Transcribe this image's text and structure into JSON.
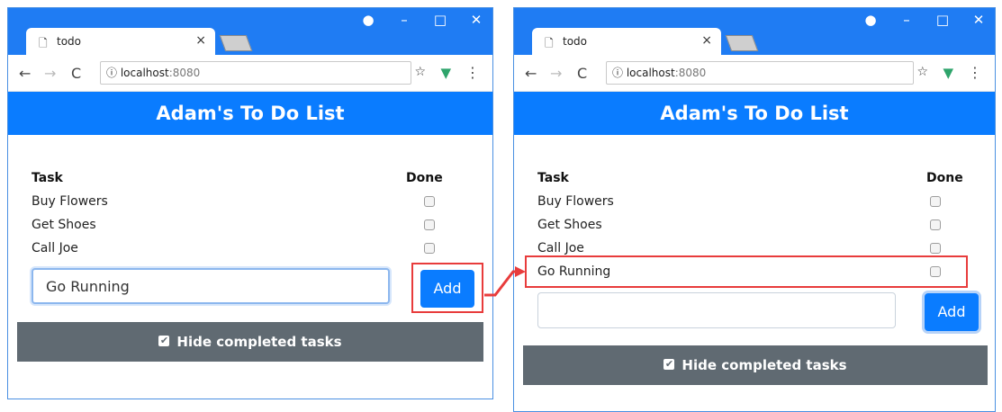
{
  "browser": {
    "tab_title": "todo",
    "tab_close": "×",
    "url_host": "localhost",
    "url_port": ":8080",
    "account_icon": "account-icon",
    "minimize": "–",
    "maximize": "□",
    "close": "✕"
  },
  "app": {
    "title": "Adam's To Do List",
    "col_task": "Task",
    "col_done": "Done",
    "tasks_before": [
      "Buy Flowers",
      "Get Shoes",
      "Call Joe"
    ],
    "tasks_after": [
      "Buy Flowers",
      "Get Shoes",
      "Call Joe",
      "Go Running"
    ],
    "input_left_value": "Go Running",
    "input_right_value": "",
    "add_label": "Add",
    "footer_label": "Hide completed tasks"
  },
  "colors": {
    "titlebar": "#1f7cf3",
    "header": "#0a7cff",
    "footer": "#606a72",
    "highlight": "#e83c3c"
  }
}
